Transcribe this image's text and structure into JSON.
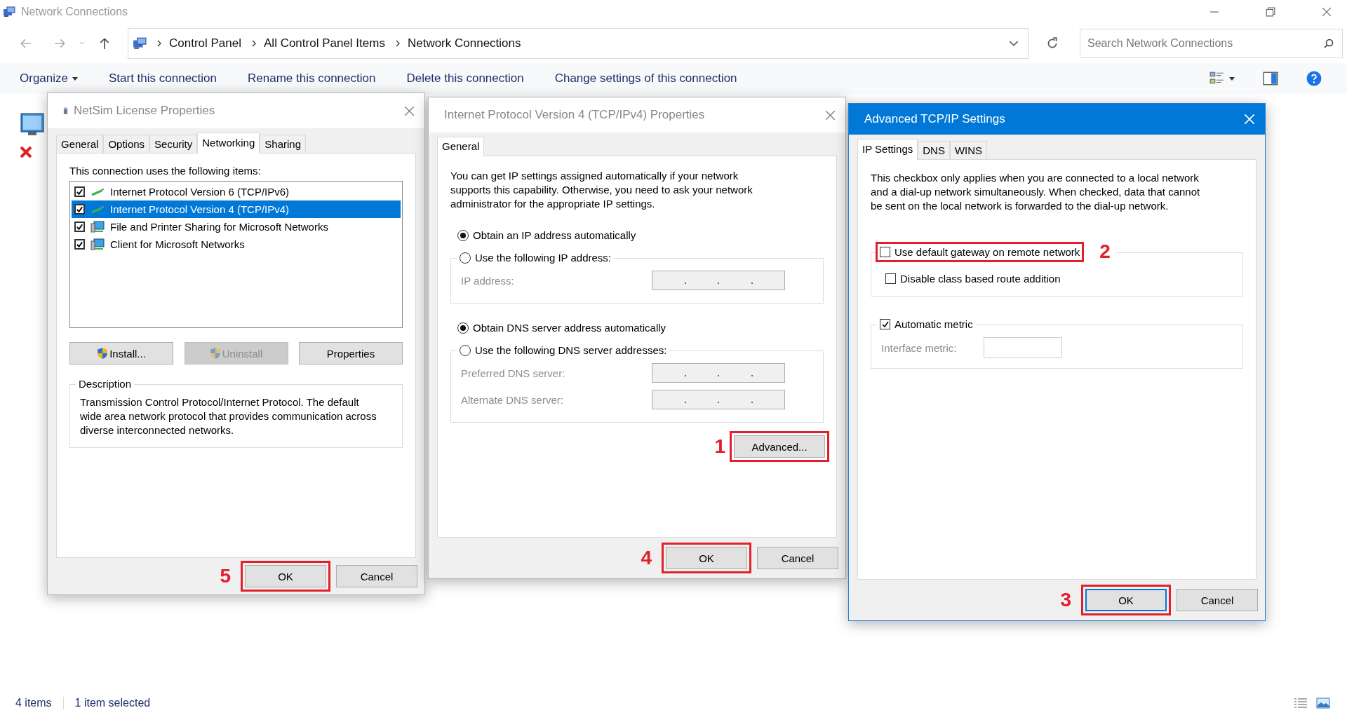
{
  "window": {
    "title": "Network Connections"
  },
  "address_bar": {
    "path": [
      "Control Panel",
      "All Control Panel Items",
      "Network Connections"
    ]
  },
  "search": {
    "placeholder": "Search Network Connections"
  },
  "command_bar": {
    "menu": "Organize",
    "items": [
      "Start this connection",
      "Rename this connection",
      "Delete this connection",
      "Change settings of this connection"
    ]
  },
  "license_dialog": {
    "title": "NetSim License Properties",
    "active": false,
    "tabs": [
      {
        "label": "General",
        "selected": false
      },
      {
        "label": "Options",
        "selected": false
      },
      {
        "label": "Security",
        "selected": false
      },
      {
        "label": "Networking",
        "selected": true
      },
      {
        "label": "Sharing",
        "selected": false
      }
    ],
    "list_label": "This connection uses the following items:",
    "items": [
      {
        "label": "Internet Protocol Version 6 (TCP/IPv6)",
        "kind": "protocol",
        "checked": true,
        "selected": false
      },
      {
        "label": "Internet Protocol Version 4 (TCP/IPv4)",
        "kind": "protocol",
        "checked": true,
        "selected": true
      },
      {
        "label": "File and Printer Sharing for Microsoft Networks",
        "kind": "service",
        "checked": true,
        "selected": false
      },
      {
        "label": "Client for Microsoft Networks",
        "kind": "service",
        "checked": true,
        "selected": false
      }
    ],
    "buttons": [
      {
        "label": "Install...",
        "shield": true,
        "disabled": false
      },
      {
        "label": "Uninstall",
        "shield": true,
        "disabled": true
      },
      {
        "label": "Properties",
        "shield": false,
        "disabled": false
      }
    ],
    "description": {
      "title": "Description",
      "text": "Transmission Control Protocol/Internet Protocol. The default wide area network protocol that provides communication across diverse interconnected networks."
    },
    "footer": [
      {
        "label": "OK",
        "callout": "5",
        "default": false
      },
      {
        "label": "Cancel",
        "default": false
      }
    ]
  },
  "ipv4_dialog": {
    "title": "Internet Protocol Version 4 (TCP/IPv4) Properties",
    "active": false,
    "tabs": [
      {
        "label": "General",
        "selected": true
      }
    ],
    "intro": "You can get IP settings assigned automatically if your network supports this capability. Otherwise, you need to ask your network administrator for the appropriate IP settings.",
    "ip_options": [
      {
        "label": "Obtain an IP address automatically",
        "selected": true
      },
      {
        "label": "Use the following IP address:",
        "selected": false
      }
    ],
    "ip_fields": [
      {
        "label": "IP address:",
        "disabled": true
      }
    ],
    "dns_options": [
      {
        "label": "Obtain DNS server address automatically",
        "selected": true
      },
      {
        "label": "Use the following DNS server addresses:",
        "selected": false
      }
    ],
    "dns_fields": [
      {
        "label": "Preferred DNS server:",
        "disabled": true
      },
      {
        "label": "Alternate DNS server:",
        "disabled": true
      }
    ],
    "advanced_button": {
      "label": "Advanced...",
      "callout": "1"
    },
    "footer": [
      {
        "label": "OK",
        "callout": "4",
        "default": false
      },
      {
        "label": "Cancel",
        "default": false
      }
    ]
  },
  "advanced_dialog": {
    "title": "Advanced TCP/IP Settings",
    "active": true,
    "tabs": [
      {
        "label": "IP Settings",
        "selected": true
      },
      {
        "label": "DNS",
        "selected": false
      },
      {
        "label": "WINS",
        "selected": false
      }
    ],
    "intro": "This checkbox only applies when you are connected to a local network and a dial-up network simultaneously.  When checked, data that cannot be sent on the local network is forwarded to the dial-up network.",
    "gateway_options": [
      {
        "label": "Use default gateway on remote network",
        "checked": false,
        "callout": "2"
      },
      {
        "label": "Disable class based route addition",
        "checked": false
      }
    ],
    "metric": {
      "label": "Automatic metric",
      "checked": true
    },
    "metric_field": {
      "label": "Interface metric:",
      "disabled": true
    },
    "footer": [
      {
        "label": "OK",
        "callout": "3",
        "default": true
      },
      {
        "label": "Cancel",
        "default": false
      }
    ]
  },
  "status_bar": {
    "items": [
      "4 items",
      "1 item selected"
    ]
  }
}
